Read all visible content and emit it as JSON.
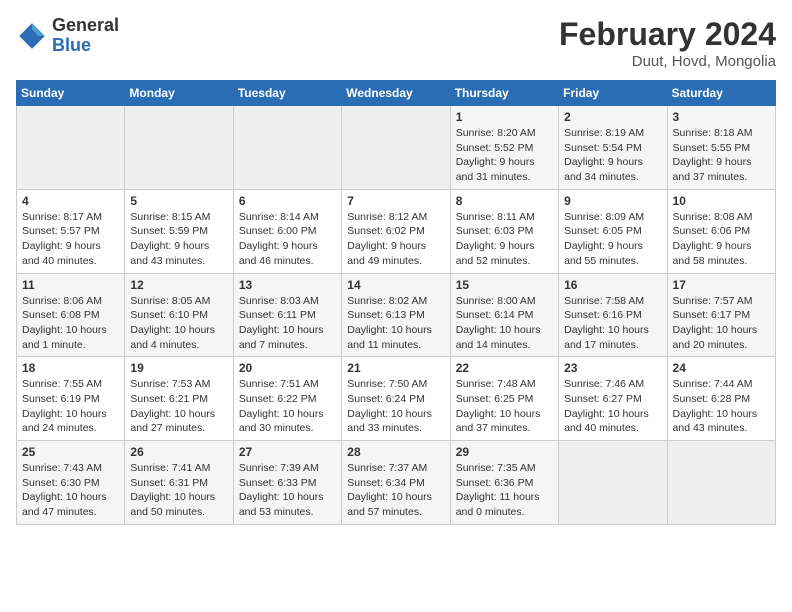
{
  "header": {
    "logo_general": "General",
    "logo_blue": "Blue",
    "month_year": "February 2024",
    "location": "Duut, Hovd, Mongolia"
  },
  "weekdays": [
    "Sunday",
    "Monday",
    "Tuesday",
    "Wednesday",
    "Thursday",
    "Friday",
    "Saturday"
  ],
  "weeks": [
    [
      {
        "day": "",
        "info": ""
      },
      {
        "day": "",
        "info": ""
      },
      {
        "day": "",
        "info": ""
      },
      {
        "day": "",
        "info": ""
      },
      {
        "day": "1",
        "info": "Sunrise: 8:20 AM\nSunset: 5:52 PM\nDaylight: 9 hours\nand 31 minutes."
      },
      {
        "day": "2",
        "info": "Sunrise: 8:19 AM\nSunset: 5:54 PM\nDaylight: 9 hours\nand 34 minutes."
      },
      {
        "day": "3",
        "info": "Sunrise: 8:18 AM\nSunset: 5:55 PM\nDaylight: 9 hours\nand 37 minutes."
      }
    ],
    [
      {
        "day": "4",
        "info": "Sunrise: 8:17 AM\nSunset: 5:57 PM\nDaylight: 9 hours\nand 40 minutes."
      },
      {
        "day": "5",
        "info": "Sunrise: 8:15 AM\nSunset: 5:59 PM\nDaylight: 9 hours\nand 43 minutes."
      },
      {
        "day": "6",
        "info": "Sunrise: 8:14 AM\nSunset: 6:00 PM\nDaylight: 9 hours\nand 46 minutes."
      },
      {
        "day": "7",
        "info": "Sunrise: 8:12 AM\nSunset: 6:02 PM\nDaylight: 9 hours\nand 49 minutes."
      },
      {
        "day": "8",
        "info": "Sunrise: 8:11 AM\nSunset: 6:03 PM\nDaylight: 9 hours\nand 52 minutes."
      },
      {
        "day": "9",
        "info": "Sunrise: 8:09 AM\nSunset: 6:05 PM\nDaylight: 9 hours\nand 55 minutes."
      },
      {
        "day": "10",
        "info": "Sunrise: 8:08 AM\nSunset: 6:06 PM\nDaylight: 9 hours\nand 58 minutes."
      }
    ],
    [
      {
        "day": "11",
        "info": "Sunrise: 8:06 AM\nSunset: 6:08 PM\nDaylight: 10 hours\nand 1 minute."
      },
      {
        "day": "12",
        "info": "Sunrise: 8:05 AM\nSunset: 6:10 PM\nDaylight: 10 hours\nand 4 minutes."
      },
      {
        "day": "13",
        "info": "Sunrise: 8:03 AM\nSunset: 6:11 PM\nDaylight: 10 hours\nand 7 minutes."
      },
      {
        "day": "14",
        "info": "Sunrise: 8:02 AM\nSunset: 6:13 PM\nDaylight: 10 hours\nand 11 minutes."
      },
      {
        "day": "15",
        "info": "Sunrise: 8:00 AM\nSunset: 6:14 PM\nDaylight: 10 hours\nand 14 minutes."
      },
      {
        "day": "16",
        "info": "Sunrise: 7:58 AM\nSunset: 6:16 PM\nDaylight: 10 hours\nand 17 minutes."
      },
      {
        "day": "17",
        "info": "Sunrise: 7:57 AM\nSunset: 6:17 PM\nDaylight: 10 hours\nand 20 minutes."
      }
    ],
    [
      {
        "day": "18",
        "info": "Sunrise: 7:55 AM\nSunset: 6:19 PM\nDaylight: 10 hours\nand 24 minutes."
      },
      {
        "day": "19",
        "info": "Sunrise: 7:53 AM\nSunset: 6:21 PM\nDaylight: 10 hours\nand 27 minutes."
      },
      {
        "day": "20",
        "info": "Sunrise: 7:51 AM\nSunset: 6:22 PM\nDaylight: 10 hours\nand 30 minutes."
      },
      {
        "day": "21",
        "info": "Sunrise: 7:50 AM\nSunset: 6:24 PM\nDaylight: 10 hours\nand 33 minutes."
      },
      {
        "day": "22",
        "info": "Sunrise: 7:48 AM\nSunset: 6:25 PM\nDaylight: 10 hours\nand 37 minutes."
      },
      {
        "day": "23",
        "info": "Sunrise: 7:46 AM\nSunset: 6:27 PM\nDaylight: 10 hours\nand 40 minutes."
      },
      {
        "day": "24",
        "info": "Sunrise: 7:44 AM\nSunset: 6:28 PM\nDaylight: 10 hours\nand 43 minutes."
      }
    ],
    [
      {
        "day": "25",
        "info": "Sunrise: 7:43 AM\nSunset: 6:30 PM\nDaylight: 10 hours\nand 47 minutes."
      },
      {
        "day": "26",
        "info": "Sunrise: 7:41 AM\nSunset: 6:31 PM\nDaylight: 10 hours\nand 50 minutes."
      },
      {
        "day": "27",
        "info": "Sunrise: 7:39 AM\nSunset: 6:33 PM\nDaylight: 10 hours\nand 53 minutes."
      },
      {
        "day": "28",
        "info": "Sunrise: 7:37 AM\nSunset: 6:34 PM\nDaylight: 10 hours\nand 57 minutes."
      },
      {
        "day": "29",
        "info": "Sunrise: 7:35 AM\nSunset: 6:36 PM\nDaylight: 11 hours\nand 0 minutes."
      },
      {
        "day": "",
        "info": ""
      },
      {
        "day": "",
        "info": ""
      }
    ]
  ]
}
